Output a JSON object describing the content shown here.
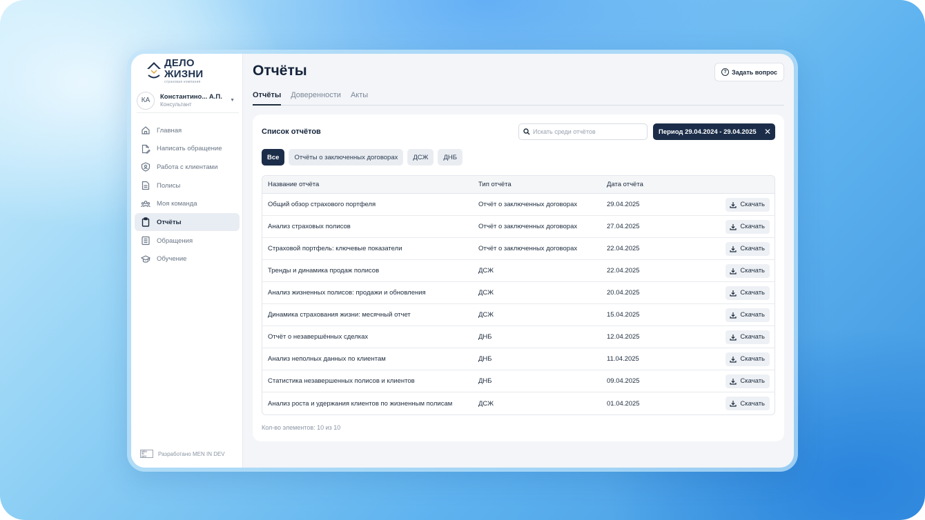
{
  "app": {
    "logo_title": "ДЕЛО ЖИЗНИ",
    "logo_subtitle": "страховая компания",
    "accent_color": "#1b2d49"
  },
  "user": {
    "initials": "КА",
    "name": "Константино... А.П.",
    "role": "Консультант"
  },
  "sidebar": {
    "items": [
      {
        "label": "Главная",
        "icon": "home-icon"
      },
      {
        "label": "Написать обращение",
        "icon": "edit-document-icon"
      },
      {
        "label": "Работа с клиентами",
        "icon": "client-shield-icon"
      },
      {
        "label": "Полисы",
        "icon": "document-icon"
      },
      {
        "label": "Моя команда",
        "icon": "team-icon"
      },
      {
        "label": "Отчёты",
        "icon": "clipboard-icon",
        "active": true
      },
      {
        "label": "Обращения",
        "icon": "list-icon"
      },
      {
        "label": "Обучение",
        "icon": "graduation-cap-icon"
      }
    ],
    "footer": "Разработано MEN IN DEV",
    "footer_logo": "MEN IN DEV"
  },
  "header": {
    "title": "Отчёты",
    "ask_button": "Задать вопрос"
  },
  "tabs": [
    {
      "label": "Отчёты",
      "active": true
    },
    {
      "label": "Доверенности",
      "active": false
    },
    {
      "label": "Акты",
      "active": false
    }
  ],
  "reports": {
    "title": "Список отчётов",
    "search_placeholder": "Искать среди отчётов",
    "period": "Период 29.04.2024 - 29.04.2025",
    "filters": [
      {
        "label": "Все",
        "active": true
      },
      {
        "label": "Отчёты о заключенных договорах",
        "active": false
      },
      {
        "label": "ДСЖ",
        "active": false
      },
      {
        "label": "ДНБ",
        "active": false
      }
    ],
    "columns": [
      "Название отчёта",
      "Тип отчёта",
      "Дата отчёта"
    ],
    "download_label": "Скачать",
    "rows": [
      {
        "name": "Общий обзор страхового портфеля",
        "type": "Отчёт о заключенных договорах",
        "date": "29.04.2025"
      },
      {
        "name": "Анализ страховых полисов",
        "type": "Отчёт о заключенных договорах",
        "date": "27.04.2025"
      },
      {
        "name": "Страховой портфель: ключевые показатели",
        "type": "Отчёт о заключенных договорах",
        "date": "22.04.2025"
      },
      {
        "name": "Тренды и динамика продаж полисов",
        "type": "ДСЖ",
        "date": "22.04.2025"
      },
      {
        "name": "Анализ жизненных полисов: продажи и обновления",
        "type": "ДСЖ",
        "date": "20.04.2025"
      },
      {
        "name": "Динамика страхования жизни: месячный отчет",
        "type": "ДСЖ",
        "date": "15.04.2025"
      },
      {
        "name": "Отчёт о незавершённых сделках",
        "type": "ДНБ",
        "date": "12.04.2025"
      },
      {
        "name": "Анализ неполных данных по клиентам",
        "type": "ДНБ",
        "date": "11.04.2025"
      },
      {
        "name": "Статистика незавершенных полисов и клиентов",
        "type": "ДНБ",
        "date": "09.04.2025"
      },
      {
        "name": "Анализ роста и удержания клиентов по жизненным полисам",
        "type": "ДСЖ",
        "date": "01.04.2025"
      }
    ],
    "count_text": "Кол-во элементов: 10 из 10"
  }
}
